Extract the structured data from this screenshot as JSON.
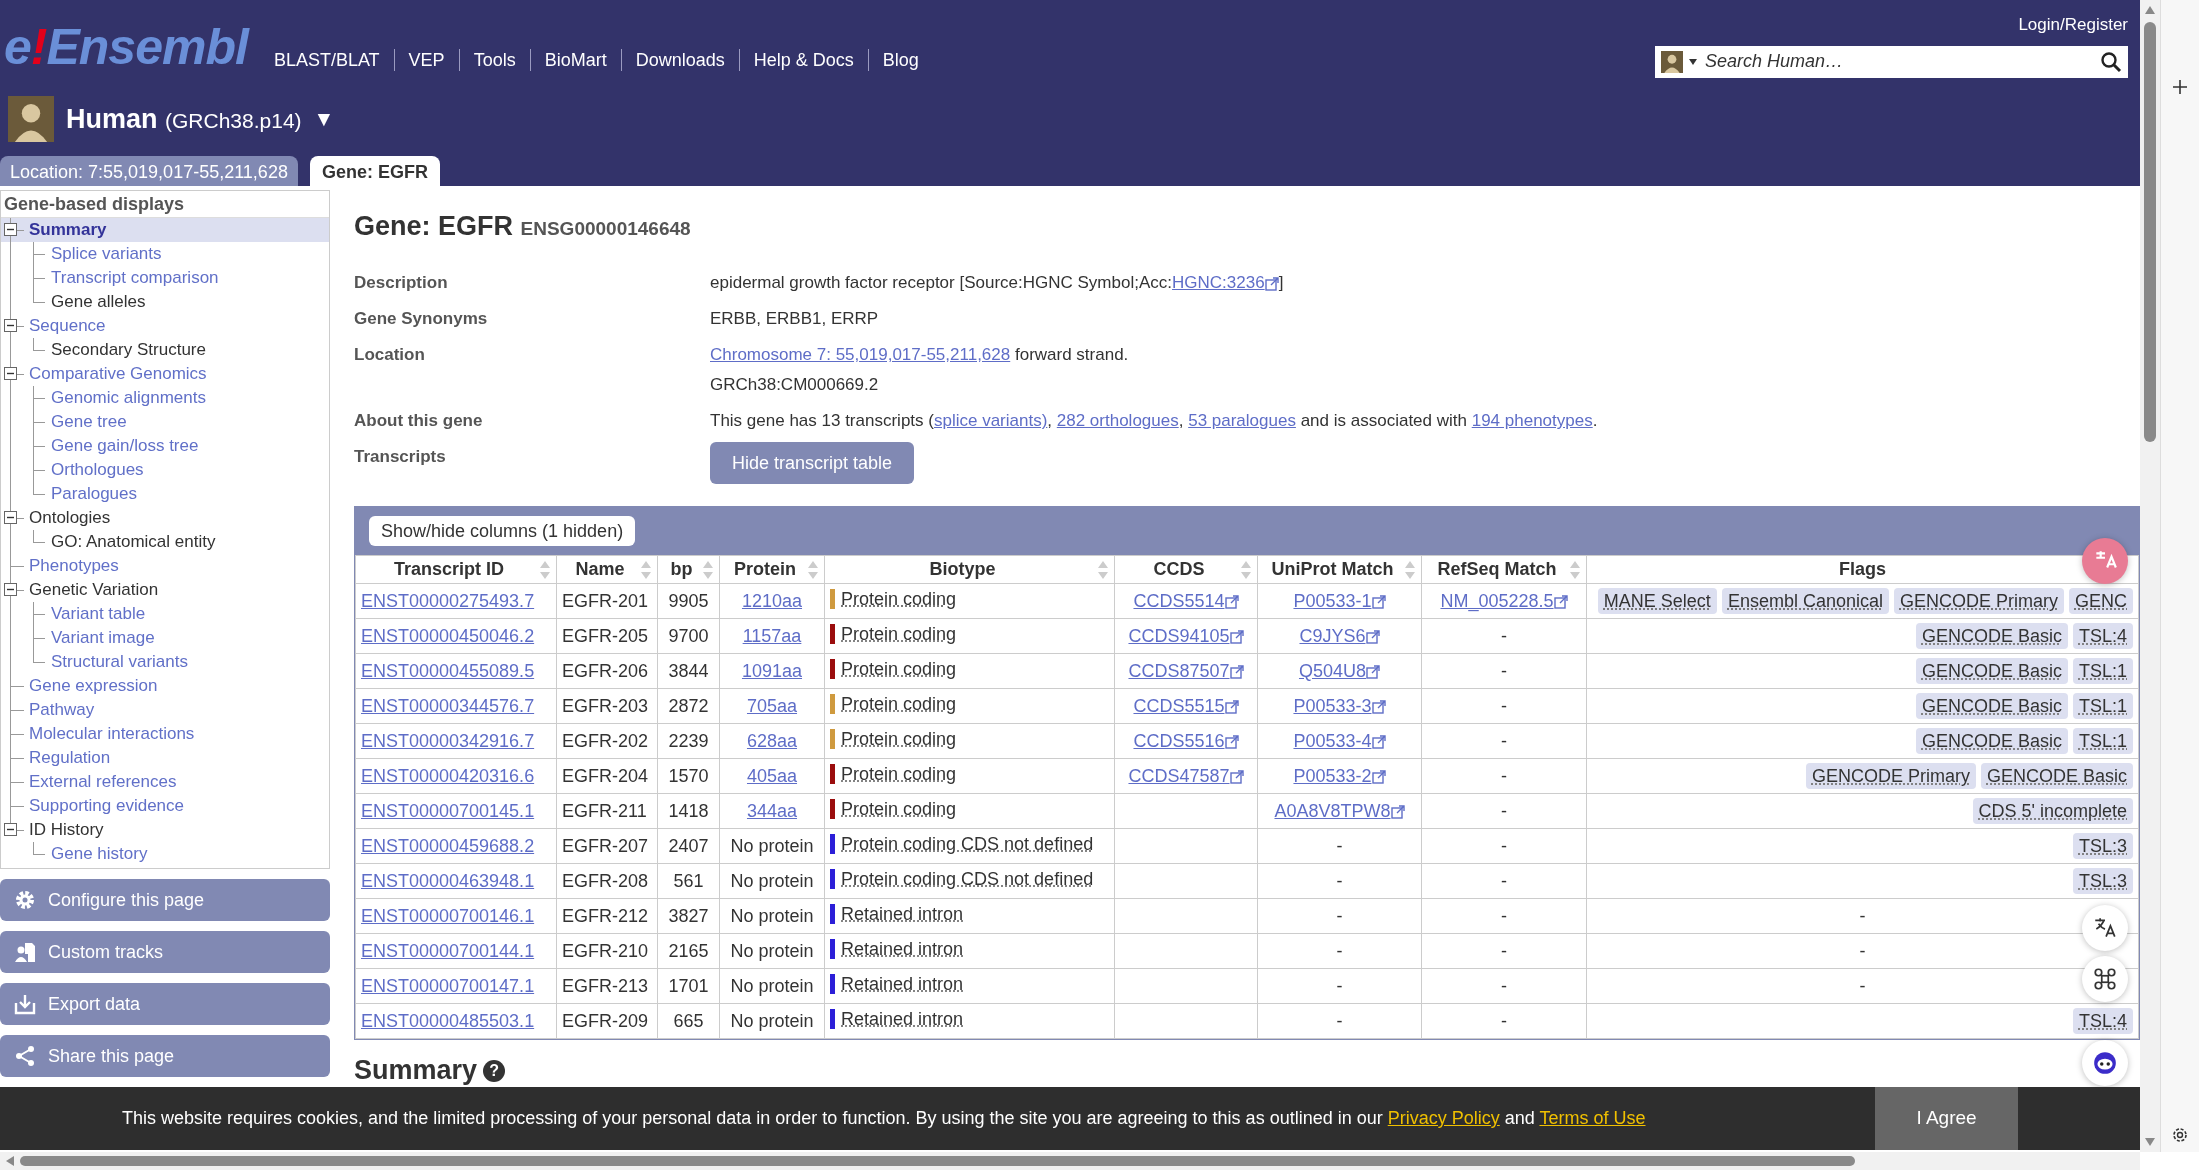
{
  "header": {
    "logo": {
      "letter": "e",
      "mark": "!",
      "name": "Ensembl"
    },
    "nav": [
      "BLAST/BLAT",
      "VEP",
      "Tools",
      "BioMart",
      "Downloads",
      "Help & Docs",
      "Blog"
    ],
    "login": "Login/Register",
    "search": {
      "placeholder": "Search Human…"
    },
    "species": {
      "name": "Human",
      "assembly": "(GRCh38.p14)",
      "caret": "▼"
    }
  },
  "tabs": [
    {
      "label": "Location: 7:55,019,017-55,211,628",
      "selected": false
    },
    {
      "label": "Gene: EGFR",
      "selected": true
    }
  ],
  "sidebar": {
    "title": "Gene-based displays",
    "items": [
      {
        "label": "Summary",
        "available": true,
        "selected": true,
        "expanded": true,
        "children": [
          {
            "label": "Splice variants",
            "available": true,
            "selected": false
          },
          {
            "label": "Transcript comparison",
            "available": true,
            "selected": false
          },
          {
            "label": "Gene alleles",
            "available": false,
            "selected": false
          }
        ]
      },
      {
        "label": "Sequence",
        "available": true,
        "selected": false,
        "expanded": true,
        "children": [
          {
            "label": "Secondary Structure",
            "available": false,
            "selected": false
          }
        ]
      },
      {
        "label": "Comparative Genomics",
        "available": true,
        "selected": false,
        "expanded": true,
        "children": [
          {
            "label": "Genomic alignments",
            "available": true,
            "selected": false
          },
          {
            "label": "Gene tree",
            "available": true,
            "selected": false
          },
          {
            "label": "Gene gain/loss tree",
            "available": true,
            "selected": false
          },
          {
            "label": "Orthologues",
            "available": true,
            "selected": false
          },
          {
            "label": "Paralogues",
            "available": true,
            "selected": false
          }
        ]
      },
      {
        "label": "Ontologies",
        "available": false,
        "selected": false,
        "expanded": true,
        "children": [
          {
            "label": "GO: Anatomical entity",
            "available": false,
            "selected": false
          }
        ]
      },
      {
        "label": "Phenotypes",
        "available": true,
        "selected": false
      },
      {
        "label": "Genetic Variation",
        "available": false,
        "selected": false,
        "expanded": true,
        "children": [
          {
            "label": "Variant table",
            "available": true,
            "selected": false
          },
          {
            "label": "Variant image",
            "available": true,
            "selected": false
          },
          {
            "label": "Structural variants",
            "available": true,
            "selected": false
          }
        ]
      },
      {
        "label": "Gene expression",
        "available": true,
        "selected": false
      },
      {
        "label": "Pathway",
        "available": true,
        "selected": false
      },
      {
        "label": "Molecular interactions",
        "available": true,
        "selected": false
      },
      {
        "label": "Regulation",
        "available": true,
        "selected": false
      },
      {
        "label": "External references",
        "available": true,
        "selected": false
      },
      {
        "label": "Supporting evidence",
        "available": true,
        "selected": false
      },
      {
        "label": "ID History",
        "available": false,
        "selected": false,
        "expanded": true,
        "children": [
          {
            "label": "Gene history",
            "available": true,
            "selected": false
          }
        ]
      }
    ],
    "buttons": [
      {
        "label": "Configure this page",
        "kind": "gear"
      },
      {
        "label": "Custom tracks",
        "kind": "tracks"
      },
      {
        "label": "Export data",
        "kind": "export"
      },
      {
        "label": "Share this page",
        "kind": "share"
      }
    ]
  },
  "gene": {
    "title": "Gene: EGFR",
    "stable_id": "ENSG00000146648",
    "fields": [
      {
        "label": "Description",
        "lines": [
          [
            {
              "text": "epidermal growth factor receptor [Source:HGNC Symbol;Acc:",
              "kind": "text"
            },
            {
              "text": "HGNC:3236",
              "kind": "external_link"
            },
            {
              "text": "]",
              "kind": "text"
            }
          ]
        ]
      },
      {
        "label": "Gene Synonyms",
        "lines": [
          [
            {
              "text": "ERBB, ERBB1, ERRP",
              "kind": "text"
            }
          ]
        ]
      },
      {
        "label": "Location",
        "lines": [
          [
            {
              "text": "Chromosome 7: 55,019,017-55,211,628",
              "kind": "link"
            },
            {
              "text": " forward strand.",
              "kind": "text"
            }
          ],
          [
            {
              "text": "GRCh38:CM000669.2",
              "kind": "text"
            }
          ]
        ]
      },
      {
        "label": "About this gene",
        "lines": [
          [
            {
              "text": "This gene has 13 transcripts (",
              "kind": "text"
            },
            {
              "text": "splice variants)",
              "kind": "link"
            },
            {
              "text": ", ",
              "kind": "text"
            },
            {
              "text": "282 orthologues",
              "kind": "link"
            },
            {
              "text": ", ",
              "kind": "text"
            },
            {
              "text": "53 paralogues",
              "kind": "link"
            },
            {
              "text": " and is associated with ",
              "kind": "text"
            },
            {
              "text": "194 phenotypes",
              "kind": "link"
            },
            {
              "text": ".",
              "kind": "text"
            }
          ]
        ]
      },
      {
        "label": "Transcripts",
        "button": "Hide transcript table"
      }
    ]
  },
  "transcripts": {
    "toggle_button": "Show/hide columns (1 hidden)",
    "columns": [
      {
        "label": "Transcript ID",
        "kind": "sortable"
      },
      {
        "label": "Name",
        "kind": "sortable"
      },
      {
        "label": "bp",
        "kind": "sortable"
      },
      {
        "label": "Protein",
        "kind": "sortable"
      },
      {
        "label": "Biotype",
        "kind": "sortable"
      },
      {
        "label": "CCDS",
        "kind": "sortable"
      },
      {
        "label": "UniProt Match",
        "kind": "sortable"
      },
      {
        "label": "RefSeq Match",
        "kind": "sortable"
      },
      {
        "label": "Flags",
        "kind": "plain"
      }
    ],
    "rows": [
      {
        "id": "ENST00000275493.7",
        "name": "EGFR-201",
        "bp": "9905",
        "protein": {
          "text": "1210aa",
          "kind": "link"
        },
        "biotype": "Protein coding",
        "color": "#cf9a3e",
        "ccds": {
          "text": "CCDS5514",
          "kind": "external_link"
        },
        "uniprot": {
          "text": "P00533-1",
          "kind": "external_link"
        },
        "refseq": {
          "text": "NM_005228.5",
          "kind": "external_link"
        },
        "flags": [
          {
            "text": "MANE Select",
            "kind": "badge"
          },
          {
            "text": "Ensembl Canonical",
            "kind": "badge"
          },
          {
            "text": "GENCODE Primary",
            "kind": "badge"
          },
          {
            "text": "GENC",
            "kind": "badge"
          }
        ]
      },
      {
        "id": "ENST00000450046.2",
        "name": "EGFR-205",
        "bp": "9700",
        "protein": {
          "text": "1157aa",
          "kind": "link"
        },
        "biotype": "Protein coding",
        "color": "#9b0d0d",
        "ccds": {
          "text": "CCDS94105",
          "kind": "external_link"
        },
        "uniprot": {
          "text": "C9JYS6",
          "kind": "external_link"
        },
        "refseq": {
          "text": "-",
          "kind": "text"
        },
        "flags": [
          {
            "text": "GENCODE Basic",
            "kind": "badge"
          },
          {
            "text": "TSL:4",
            "kind": "badge"
          }
        ]
      },
      {
        "id": "ENST00000455089.5",
        "name": "EGFR-206",
        "bp": "3844",
        "protein": {
          "text": "1091aa",
          "kind": "link"
        },
        "biotype": "Protein coding",
        "color": "#9b0d0d",
        "ccds": {
          "text": "CCDS87507",
          "kind": "external_link"
        },
        "uniprot": {
          "text": "Q504U8",
          "kind": "external_link"
        },
        "refseq": {
          "text": "-",
          "kind": "text"
        },
        "flags": [
          {
            "text": "GENCODE Basic",
            "kind": "badge"
          },
          {
            "text": "TSL:1",
            "kind": "badge"
          }
        ]
      },
      {
        "id": "ENST00000344576.7",
        "name": "EGFR-203",
        "bp": "2872",
        "protein": {
          "text": "705aa",
          "kind": "link"
        },
        "biotype": "Protein coding",
        "color": "#cf9a3e",
        "ccds": {
          "text": "CCDS5515",
          "kind": "external_link"
        },
        "uniprot": {
          "text": "P00533-3",
          "kind": "external_link"
        },
        "refseq": {
          "text": "-",
          "kind": "text"
        },
        "flags": [
          {
            "text": "GENCODE Basic",
            "kind": "badge"
          },
          {
            "text": "TSL:1",
            "kind": "badge"
          }
        ]
      },
      {
        "id": "ENST00000342916.7",
        "name": "EGFR-202",
        "bp": "2239",
        "protein": {
          "text": "628aa",
          "kind": "link"
        },
        "biotype": "Protein coding",
        "color": "#cf9a3e",
        "ccds": {
          "text": "CCDS5516",
          "kind": "external_link"
        },
        "uniprot": {
          "text": "P00533-4",
          "kind": "external_link"
        },
        "refseq": {
          "text": "-",
          "kind": "text"
        },
        "flags": [
          {
            "text": "GENCODE Basic",
            "kind": "badge"
          },
          {
            "text": "TSL:1",
            "kind": "badge"
          }
        ]
      },
      {
        "id": "ENST00000420316.6",
        "name": "EGFR-204",
        "bp": "1570",
        "protein": {
          "text": "405aa",
          "kind": "link"
        },
        "biotype": "Protein coding",
        "color": "#9b0d0d",
        "ccds": {
          "text": "CCDS47587",
          "kind": "external_link"
        },
        "uniprot": {
          "text": "P00533-2",
          "kind": "external_link"
        },
        "refseq": {
          "text": "-",
          "kind": "text"
        },
        "flags": [
          {
            "text": "GENCODE Primary",
            "kind": "badge"
          },
          {
            "text": "GENCODE Basic",
            "kind": "badge"
          }
        ]
      },
      {
        "id": "ENST00000700145.1",
        "name": "EGFR-211",
        "bp": "1418",
        "protein": {
          "text": "344aa",
          "kind": "link"
        },
        "biotype": "Protein coding",
        "color": "#9b0d0d",
        "uniprot": {
          "text": "A0A8V8TPW8",
          "kind": "external_link"
        },
        "refseq": {
          "text": "-",
          "kind": "text"
        },
        "flags": [
          {
            "text": "CDS 5' incomplete",
            "kind": "badge"
          }
        ]
      },
      {
        "id": "ENST00000459688.2",
        "name": "EGFR-207",
        "bp": "2407",
        "protein": {
          "text": "No protein",
          "kind": "text"
        },
        "biotype": "Protein coding CDS not defined",
        "color": "#2c1fd8",
        "uniprot": {
          "text": "-",
          "kind": "text"
        },
        "refseq": {
          "text": "-",
          "kind": "text"
        },
        "flags": [
          {
            "text": "TSL:3",
            "kind": "badge"
          }
        ]
      },
      {
        "id": "ENST00000463948.1",
        "name": "EGFR-208",
        "bp": "561",
        "protein": {
          "text": "No protein",
          "kind": "text"
        },
        "biotype": "Protein coding CDS not defined",
        "color": "#2c1fd8",
        "uniprot": {
          "text": "-",
          "kind": "text"
        },
        "refseq": {
          "text": "-",
          "kind": "text"
        },
        "flags": [
          {
            "text": "TSL:3",
            "kind": "badge"
          }
        ]
      },
      {
        "id": "ENST00000700146.1",
        "name": "EGFR-212",
        "bp": "3827",
        "protein": {
          "text": "No protein",
          "kind": "text"
        },
        "biotype": "Retained intron",
        "color": "#2c1fd8",
        "uniprot": {
          "text": "-",
          "kind": "text"
        },
        "refseq": {
          "text": "-",
          "kind": "text"
        },
        "flags": [
          {
            "text": "-",
            "kind": "plain"
          }
        ]
      },
      {
        "id": "ENST00000700144.1",
        "name": "EGFR-210",
        "bp": "2165",
        "protein": {
          "text": "No protein",
          "kind": "text"
        },
        "biotype": "Retained intron",
        "color": "#2c1fd8",
        "uniprot": {
          "text": "-",
          "kind": "text"
        },
        "refseq": {
          "text": "-",
          "kind": "text"
        },
        "flags": [
          {
            "text": "-",
            "kind": "plain"
          }
        ]
      },
      {
        "id": "ENST00000700147.1",
        "name": "EGFR-213",
        "bp": "1701",
        "protein": {
          "text": "No protein",
          "kind": "text"
        },
        "biotype": "Retained intron",
        "color": "#2c1fd8",
        "uniprot": {
          "text": "-",
          "kind": "text"
        },
        "refseq": {
          "text": "-",
          "kind": "text"
        },
        "flags": [
          {
            "text": "-",
            "kind": "plain"
          }
        ]
      },
      {
        "id": "ENST00000485503.1",
        "name": "EGFR-209",
        "bp": "665",
        "protein": {
          "text": "No protein",
          "kind": "text"
        },
        "biotype": "Retained intron",
        "color": "#2c1fd8",
        "uniprot": {
          "text": "-",
          "kind": "text"
        },
        "refseq": {
          "text": "-",
          "kind": "text"
        },
        "flags": [
          {
            "text": "TSL:4",
            "kind": "badge"
          }
        ]
      }
    ]
  },
  "summary": {
    "title": "Summary",
    "help": "?"
  },
  "cookie": {
    "parts": [
      {
        "text": "This website requires cookies, and the limited processing of your personal data in order to function. By using the site you are agreeing to this as outlined in our ",
        "kind": "text"
      },
      {
        "text": "Privacy Policy",
        "kind": "link"
      },
      {
        "text": " and ",
        "kind": "text"
      },
      {
        "text": "Terms of Use",
        "kind": "link"
      }
    ],
    "button": "I Agree"
  }
}
